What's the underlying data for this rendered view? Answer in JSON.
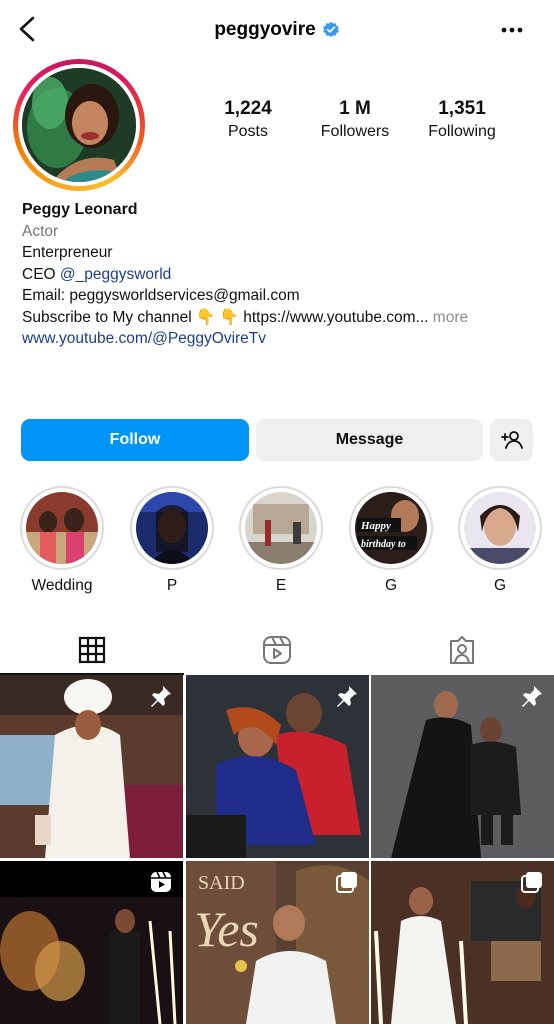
{
  "header": {
    "username": "peggyovire"
  },
  "stats": [
    {
      "value": "1,224",
      "label": "Posts"
    },
    {
      "value": "1 M",
      "label": "Followers"
    },
    {
      "value": "1,351",
      "label": "Following"
    }
  ],
  "bio": {
    "name": "Peggy Leonard",
    "category": "Actor",
    "line1": "Enterpreneur",
    "line2_prefix": "CEO ",
    "line2_mention": "@_peggysworld",
    "line3": "Email: peggysworldservices@gmail.com",
    "line4": "Subscribe to My channel 👇 👇 https://www.youtube.com...",
    "more": "more",
    "website": "www.youtube.com/@PeggyOvireTv"
  },
  "buttons": {
    "follow": "Follow",
    "message": "Message"
  },
  "highlights": [
    {
      "label": "Wedding"
    },
    {
      "label": "P"
    },
    {
      "label": "E"
    },
    {
      "label": "G",
      "overlay_text": "Happy birthday to"
    },
    {
      "label": "G"
    }
  ],
  "tabs": [
    {
      "icon": "grid-icon"
    },
    {
      "icon": "reels-icon"
    },
    {
      "icon": "tagged-icon"
    }
  ],
  "posts": [
    {
      "badge": "pin-icon"
    },
    {
      "badge": "pin-icon"
    },
    {
      "badge": "pin-icon"
    },
    {
      "badge": "reels-icon"
    },
    {
      "badge": "carousel-icon",
      "overlay_text": "SAID Yes"
    },
    {
      "badge": "carousel-icon"
    }
  ],
  "colors": {
    "accent": "#0095f6",
    "verified": "#3897f0",
    "link": "#1c3f8b",
    "secondary_button": "#efefef"
  }
}
